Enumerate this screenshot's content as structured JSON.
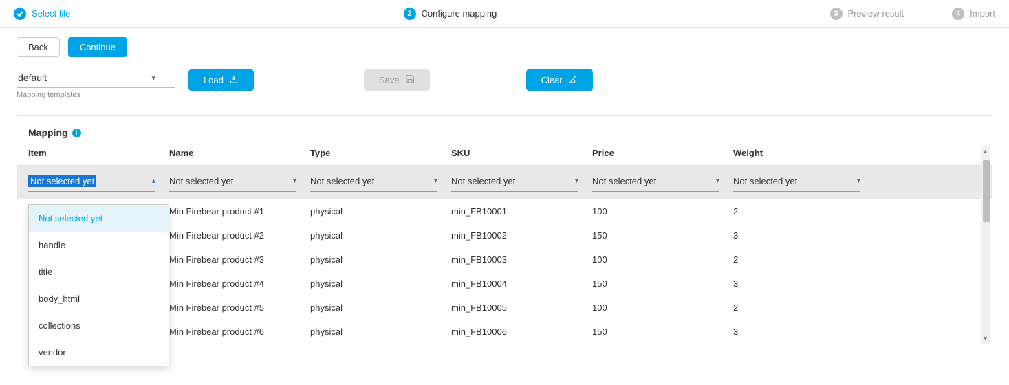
{
  "stepper": {
    "steps": [
      {
        "label": "Select file",
        "state": "done"
      },
      {
        "label": "Configure mapping",
        "state": "active",
        "num": "2"
      },
      {
        "label": "Preview result",
        "state": "todo",
        "num": "3"
      },
      {
        "label": "Import",
        "state": "todo",
        "num": "4"
      }
    ]
  },
  "actions": {
    "back": "Back",
    "continue": "Continue"
  },
  "templates": {
    "selected": "default",
    "helper": "Mapping templates",
    "load": "Load",
    "save": "Save",
    "clear": "Clear"
  },
  "mapping": {
    "title": "Mapping",
    "headers": {
      "item": "Item",
      "name": "Name",
      "type": "Type",
      "sku": "SKU",
      "price": "Price",
      "weight": "Weight"
    },
    "placeholder": "Not selected yet",
    "dropdown_open_on": "item",
    "dropdown_options": [
      "Not selected yet",
      "handle",
      "title",
      "body_html",
      "collections",
      "vendor"
    ],
    "rows": [
      {
        "name": "Min Firebear product #1",
        "type": "physical",
        "sku": "min_FB10001",
        "price": "100",
        "weight": "2"
      },
      {
        "name": "Min Firebear product #2",
        "type": "physical",
        "sku": "min_FB10002",
        "price": "150",
        "weight": "3"
      },
      {
        "name": "Min Firebear product #3",
        "type": "physical",
        "sku": "min_FB10003",
        "price": "100",
        "weight": "2"
      },
      {
        "name": "Min Firebear product #4",
        "type": "physical",
        "sku": "min_FB10004",
        "price": "150",
        "weight": "3"
      },
      {
        "name": "Min Firebear product #5",
        "type": "physical",
        "sku": "min_FB10005",
        "price": "100",
        "weight": "2"
      },
      {
        "name": "Min Firebear product #6",
        "type": "physical",
        "sku": "min_FB10006",
        "price": "150",
        "weight": "3"
      }
    ]
  }
}
